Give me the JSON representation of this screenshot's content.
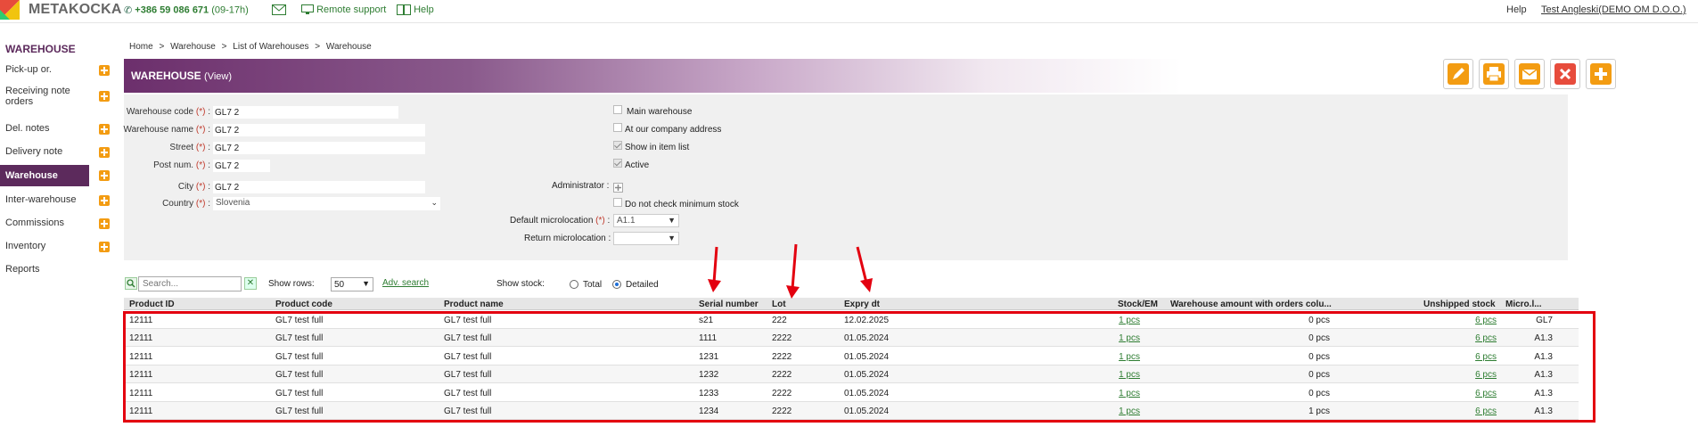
{
  "topbar": {
    "brand": "METAKOCKA",
    "phone_number": "+386 59 086 671",
    "phone_hours": "(09-17h)",
    "remote_support": "Remote support",
    "help_link": "Help",
    "help_right": "Help",
    "user": "Test Angleski(DEMO OM D.O.O.)",
    "colors": {
      "accent": "#5c2a5c",
      "link": "#2e7d32"
    }
  },
  "sidebar": {
    "title": "WAREHOUSE",
    "items": [
      {
        "label": "Pick-up or.",
        "active": false
      },
      {
        "label": "Receiving note orders",
        "active": false
      },
      {
        "label": "Del. notes",
        "active": false
      },
      {
        "label": "Delivery note",
        "active": false
      },
      {
        "label": "Warehouse",
        "active": true
      },
      {
        "label": "Inter-warehouse",
        "active": false
      },
      {
        "label": "Commissions",
        "active": false
      },
      {
        "label": "Inventory",
        "active": false
      },
      {
        "label": "Reports",
        "active": false
      }
    ]
  },
  "breadcrumb": [
    "Home",
    ">",
    "Warehouse",
    ">",
    "List of Warehouses",
    ">",
    "Warehouse"
  ],
  "header": {
    "title": "WAREHOUSE",
    "mode": "(View)"
  },
  "actions": [
    {
      "name": "edit-icon",
      "color": "#f39c12"
    },
    {
      "name": "print-icon",
      "color": "#f39c12"
    },
    {
      "name": "email-icon",
      "color": "#f39c12"
    },
    {
      "name": "delete-icon",
      "color": "#e74c3c"
    },
    {
      "name": "add-icon",
      "color": "#f39c12"
    }
  ],
  "form": {
    "left": [
      {
        "label": "Warehouse code",
        "req": "(*)",
        "value": "GL7 2"
      },
      {
        "label": "Warehouse name",
        "req": "(*)",
        "value": "GL7 2"
      },
      {
        "label": "Street",
        "req": "(*)",
        "value": "GL7 2"
      },
      {
        "label": "Post num.",
        "req": "(*)",
        "value": "GL7 2"
      },
      {
        "label": "City",
        "req": "(*)",
        "value": "GL7 2"
      },
      {
        "label": "Country",
        "req": "(*)",
        "value": "Slovenia"
      }
    ],
    "checkboxes": [
      {
        "label": "Main warehouse",
        "checked": false
      },
      {
        "label": "At our company address",
        "checked": false
      },
      {
        "label": "Show in item list",
        "checked": true
      },
      {
        "label": "Active",
        "checked": true
      }
    ],
    "administrator_label": "Administrator :",
    "min_stock_label": "Do not check minimum stock",
    "default_micro_label": "Default microlocation",
    "default_micro_req": "(*)",
    "default_micro_value": "A1.1",
    "return_micro_label": "Return microlocation :",
    "return_micro_value": ""
  },
  "toolbar": {
    "search_placeholder": "Search...",
    "show_rows_label": "Show rows:",
    "show_rows_value": "50",
    "adv_search": "Adv. search",
    "show_stock_label": "Show stock:",
    "total_label": "Total",
    "detailed_label": "Detailed",
    "selected": "Detailed"
  },
  "table": {
    "columns": [
      "Product ID",
      "Product code",
      "Product name",
      "Serial number",
      "Lot",
      "Expry dt",
      "Stock/EM",
      "Warehouse amount with orders colu...",
      "Unshipped stock",
      "Micro.l..."
    ],
    "rows": [
      {
        "id": "12111",
        "code": "GL7 test full",
        "name": "GL7 test full",
        "serial": "s21",
        "lot": "222",
        "expiry": "12.02.2025",
        "stock": "1 pcs",
        "amount": "0 pcs",
        "unshipped": "6 pcs",
        "micro": "GL7"
      },
      {
        "id": "12111",
        "code": "GL7 test full",
        "name": "GL7 test full",
        "serial": "1111",
        "lot": "2222",
        "expiry": "01.05.2024",
        "stock": "1 pcs",
        "amount": "0 pcs",
        "unshipped": "6 pcs",
        "micro": "A1.3"
      },
      {
        "id": "12111",
        "code": "GL7 test full",
        "name": "GL7 test full",
        "serial": "1231",
        "lot": "2222",
        "expiry": "01.05.2024",
        "stock": "1 pcs",
        "amount": "0 pcs",
        "unshipped": "6 pcs",
        "micro": "A1.3"
      },
      {
        "id": "12111",
        "code": "GL7 test full",
        "name": "GL7 test full",
        "serial": "1232",
        "lot": "2222",
        "expiry": "01.05.2024",
        "stock": "1 pcs",
        "amount": "0 pcs",
        "unshipped": "6 pcs",
        "micro": "A1.3"
      },
      {
        "id": "12111",
        "code": "GL7 test full",
        "name": "GL7 test full",
        "serial": "1233",
        "lot": "2222",
        "expiry": "01.05.2024",
        "stock": "1 pcs",
        "amount": "0 pcs",
        "unshipped": "6 pcs",
        "micro": "A1.3"
      },
      {
        "id": "12111",
        "code": "GL7 test full",
        "name": "GL7 test full",
        "serial": "1234",
        "lot": "2222",
        "expiry": "01.05.2024",
        "stock": "1 pcs",
        "amount": "1 pcs",
        "unshipped": "6 pcs",
        "micro": "A1.3"
      }
    ]
  },
  "annotations": {
    "highlight_color": "#e3000f"
  }
}
